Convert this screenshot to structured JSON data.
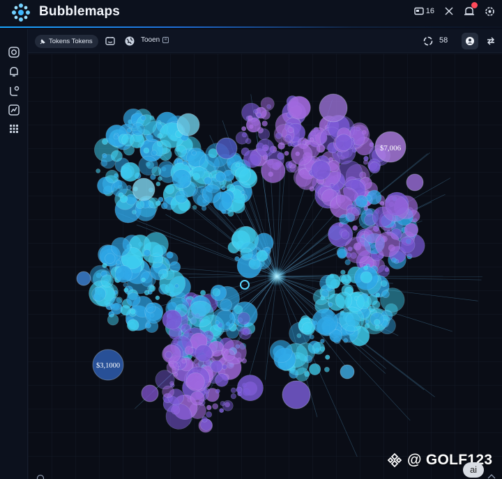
{
  "header": {
    "brand": "Bubblemaps",
    "top_count": "16"
  },
  "toolbar": {
    "chip_label": "Tokens Tokens",
    "token_label": "Tooen",
    "count": "58"
  },
  "bubbles": {
    "labels": [
      {
        "text": "$7,006",
        "color": "#ffffff"
      },
      {
        "text": "$3,1000",
        "color": "#ffffff"
      }
    ]
  },
  "watermark": {
    "text": "@ GOLF123"
  },
  "ai_badge": "ai",
  "colors": {
    "blue": "#2fa8e8",
    "cyan": "#3fd0f0",
    "purple": "#a56be0",
    "violet": "#7b5ad8",
    "background": "#0a0d16"
  },
  "icons": {
    "logo": "bubble-cluster-logo",
    "rail": [
      "instagram-icon",
      "bell-icon",
      "connect-icon",
      "chart-icon",
      "grid-icon"
    ],
    "top": [
      "wallet-icon",
      "swap-icon",
      "notification-icon",
      "settings-icon"
    ]
  }
}
